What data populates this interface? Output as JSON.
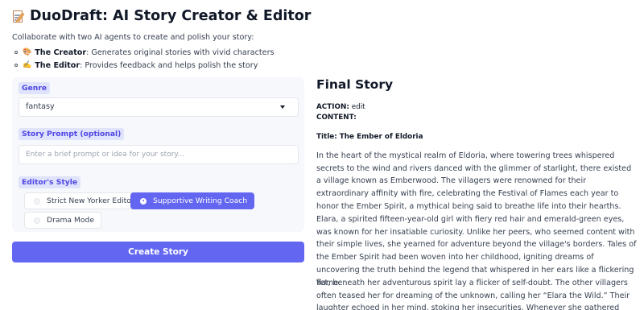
{
  "header": {
    "title": "DuoDraft: AI Story Creator & Editor",
    "icon": "memo-icon"
  },
  "intro": {
    "text": "Collaborate with two AI agents to create and polish your story:",
    "bullets": [
      {
        "emoji": "🎨",
        "name": "The Creator",
        "desc": ": Generates original stories with vivid characters"
      },
      {
        "emoji": "✍️",
        "name": "The Editor",
        "desc": ": Provides feedback and helps polish the story"
      }
    ]
  },
  "form": {
    "genre": {
      "label": "Genre",
      "value": "fantasy"
    },
    "prompt": {
      "label": "Story Prompt (optional)",
      "placeholder": "Enter a brief prompt or idea for your story..."
    },
    "style": {
      "label": "Editor's Style",
      "options": [
        "Strict New Yorker Editor",
        "Supportive Writing Coach",
        "Drama Mode"
      ],
      "selected": "Supportive Writing Coach"
    },
    "submit_label": "Create Story"
  },
  "output": {
    "heading": "Final Story",
    "action_label": "ACTION:",
    "action_value": "edit",
    "content_label": "CONTENT:",
    "story_title": "Title: The Ember of Eldoria",
    "paragraphs": [
      "In the heart of the mystical realm of Eldoria, where towering trees whispered secrets to the wind and rivers danced with the glimmer of starlight, there existed a village known as Emberwood. The villagers were renowned for their extraordinary affinity with fire, celebrating the Festival of Flames each year to honor the Ember Spirit, a mythical being said to breathe life into their hearths.",
      "Elara, a spirited fifteen-year-old girl with fiery red hair and emerald-green eyes, was known for her insatiable curiosity. Unlike her peers, who seemed content with their simple lives, she yearned for adventure beyond the village's borders. Tales of the Ember Spirit had been woven into her childhood, igniting dreams of uncovering the truth behind the legend that whispered in her ears like a flickering flame.",
      "Yet, beneath her adventurous spirit lay a flicker of self-doubt. The other villagers often teased her for dreaming of the unknown, calling her “Elara the Wild.” Their laughter echoed in her mind, stoking her insecurities. Whenever she gathered"
    ]
  }
}
